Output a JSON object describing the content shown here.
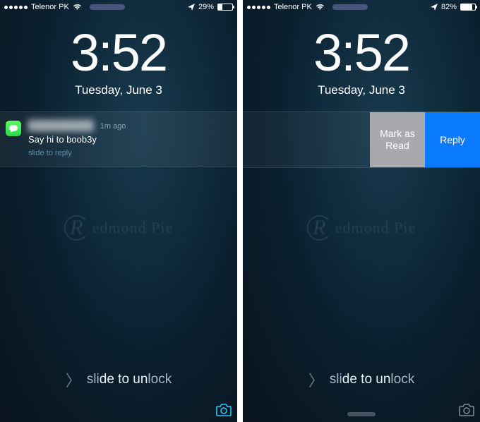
{
  "colors": {
    "blue_action": "#0a7bff",
    "gray_action": "#a7a9ad",
    "message_green": "#2bd84c"
  },
  "watermark": "edmond Pie",
  "screens": [
    {
      "status": {
        "carrier": "Telenor PK",
        "battery_pct": "29%",
        "battery_fill": 29
      },
      "clock": {
        "time": "3:52",
        "date": "Tuesday, June 3"
      },
      "notification": {
        "sender_blurred": "██████████",
        "timestamp": "1m ago",
        "message": "Say hi to boob3y",
        "hint": "slide to reply"
      },
      "unlock": {
        "chevron": "〉",
        "dim": "sli",
        "bright": "de to un",
        "dim2": "lock"
      }
    },
    {
      "status": {
        "carrier": "Telenor PK",
        "battery_pct": "82%",
        "battery_fill": 82
      },
      "clock": {
        "time": "3:52",
        "date": "Tuesday, June 3"
      },
      "actions": {
        "mark_read": "Mark as Read",
        "reply": "Reply"
      },
      "unlock": {
        "chevron": "〉",
        "dim": "sli",
        "bright": "de to un",
        "dim2": "lock"
      }
    }
  ]
}
